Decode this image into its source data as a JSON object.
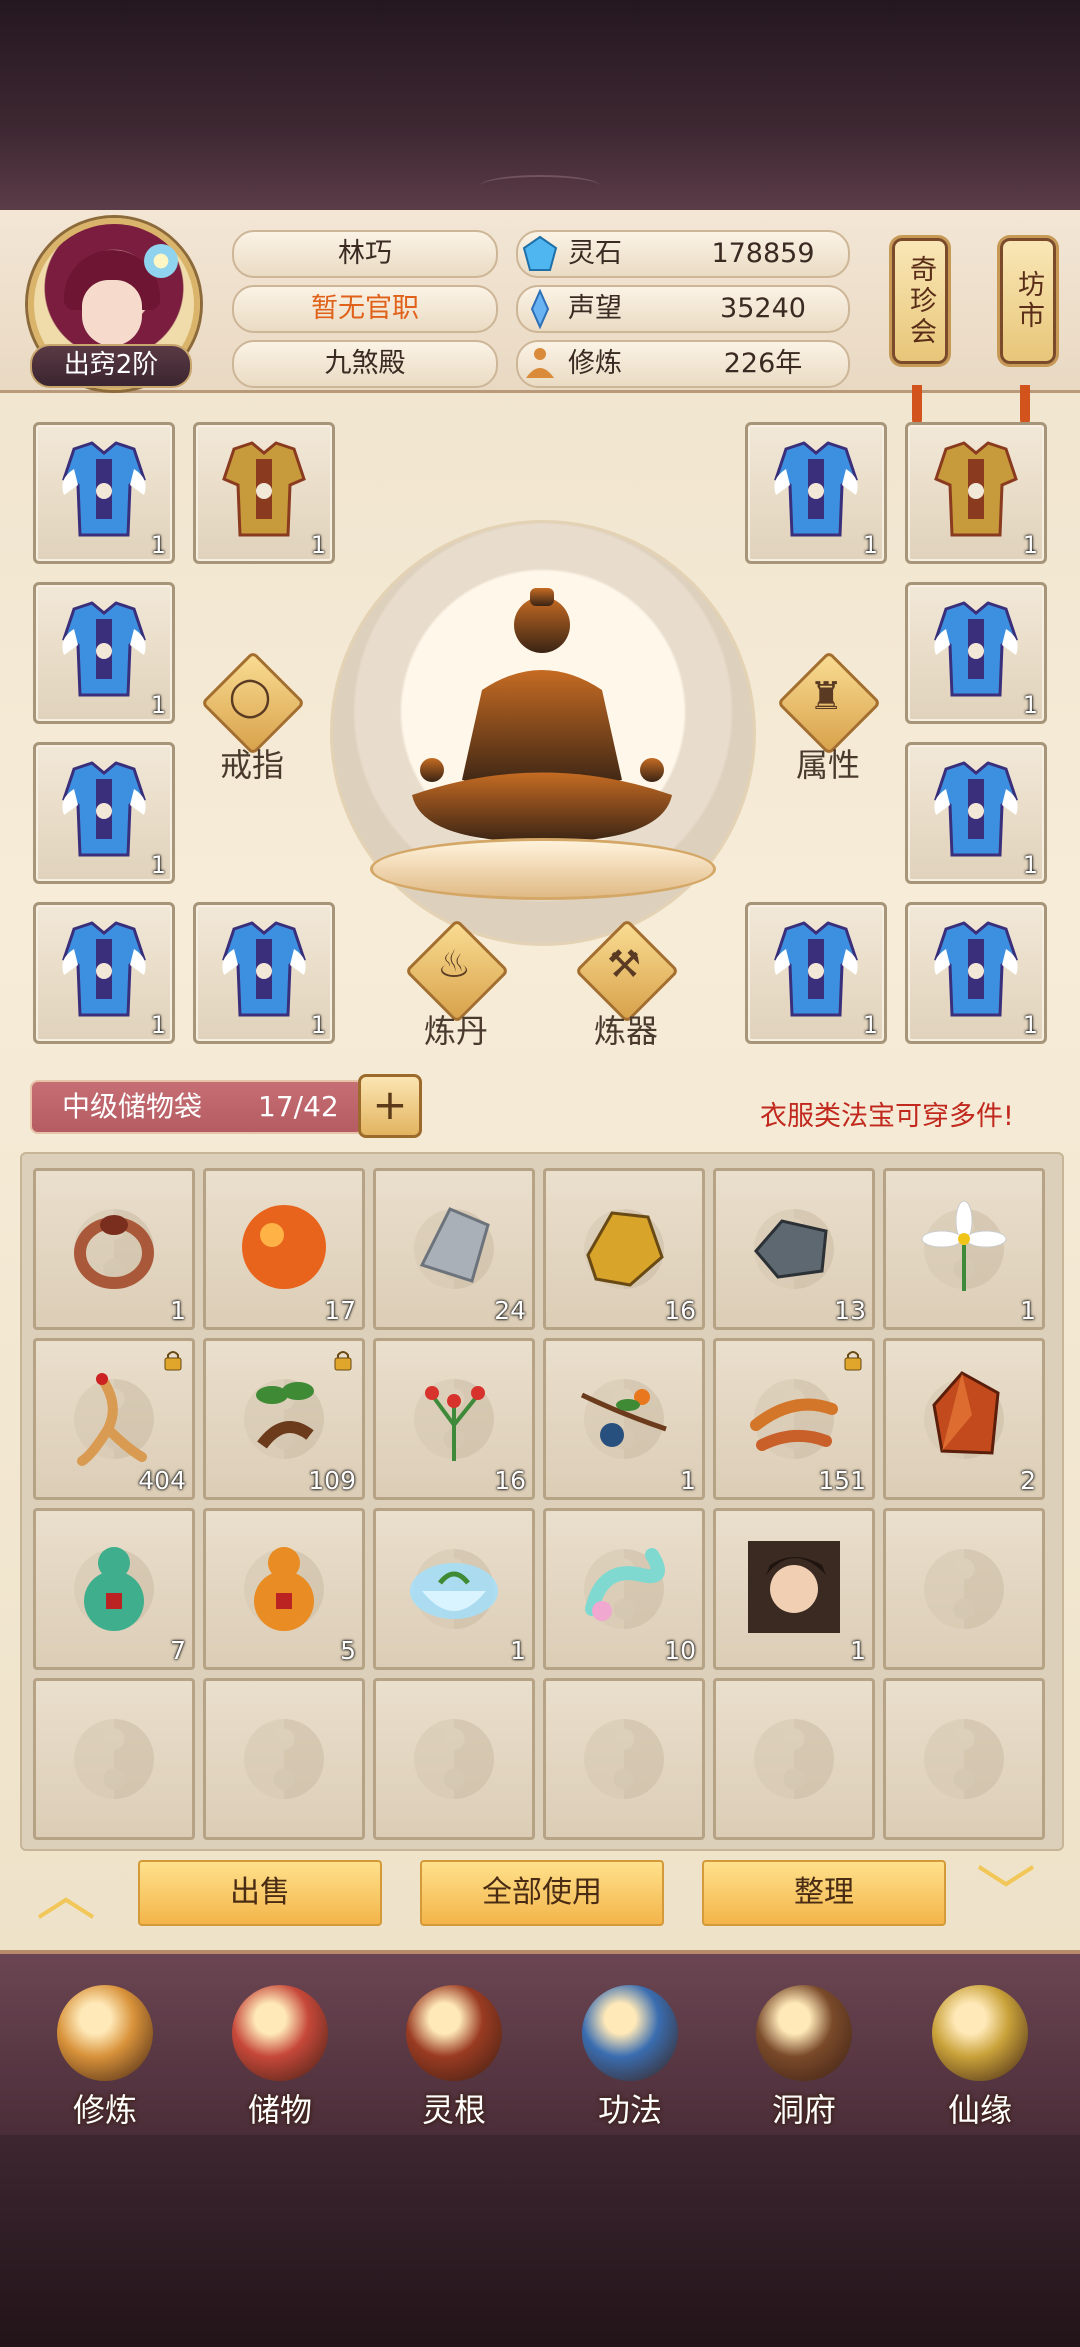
{
  "player": {
    "name": "林巧",
    "office": "暂无官职",
    "sect": "九煞殿",
    "rank": "出窍2阶"
  },
  "resources": [
    {
      "label": "灵石",
      "value": "178859",
      "icon": "spirit-stone-icon"
    },
    {
      "label": "声望",
      "value": "35240",
      "icon": "prestige-icon"
    },
    {
      "label": "修炼",
      "value": "226年",
      "icon": "cultivation-icon"
    }
  ],
  "side_tags": {
    "shop_treasure": "奇珍会",
    "market": "坊市"
  },
  "equipment": {
    "count_label": "1",
    "actions": {
      "ring": "戒指",
      "attributes": "属性",
      "alchemy": "炼丹",
      "forging": "炼器"
    }
  },
  "bag": {
    "name": "中级储物袋",
    "capacity": "17/42",
    "add_label": "+",
    "tip": "衣服类法宝可穿多件!",
    "items": [
      {
        "icon": "ring-icon",
        "count": "1",
        "locked": false
      },
      {
        "icon": "fire-orb-icon",
        "count": "17",
        "locked": false
      },
      {
        "icon": "silver-ore-icon",
        "count": "24",
        "locked": false
      },
      {
        "icon": "gold-ore-icon",
        "count": "16",
        "locked": false
      },
      {
        "icon": "iron-ore-icon",
        "count": "13",
        "locked": false
      },
      {
        "icon": "white-flower-icon",
        "count": "1",
        "locked": false
      },
      {
        "icon": "ginseng-icon",
        "count": "404",
        "locked": true
      },
      {
        "icon": "herb-root-icon",
        "count": "109",
        "locked": true
      },
      {
        "icon": "red-herb-icon",
        "count": "16",
        "locked": false
      },
      {
        "icon": "fruit-branch-icon",
        "count": "1",
        "locked": false
      },
      {
        "icon": "cordyceps-icon",
        "count": "151",
        "locked": true
      },
      {
        "icon": "red-crystal-icon",
        "count": "2",
        "locked": false
      },
      {
        "icon": "green-gourd-icon",
        "count": "7",
        "locked": false
      },
      {
        "icon": "orange-gourd-icon",
        "count": "5",
        "locked": false
      },
      {
        "icon": "jade-bowl-icon",
        "count": "1",
        "locked": false
      },
      {
        "icon": "cloud-ribbon-icon",
        "count": "10",
        "locked": false
      },
      {
        "icon": "hero-portrait-icon",
        "count": "1",
        "locked": false
      }
    ]
  },
  "actions": {
    "sell": "出售",
    "use_all": "全部使用",
    "sort": "整理"
  },
  "nav": [
    {
      "label": "修炼",
      "icon": "cultivate-nav-icon"
    },
    {
      "label": "储物",
      "icon": "storage-nav-icon"
    },
    {
      "label": "灵根",
      "icon": "spirit-root-nav-icon"
    },
    {
      "label": "功法",
      "icon": "technique-nav-icon"
    },
    {
      "label": "洞府",
      "icon": "cave-nav-icon"
    },
    {
      "label": "仙缘",
      "icon": "fate-nav-icon"
    }
  ],
  "colors": {
    "accent_gold": "#f3b54a",
    "warning_red": "#c1281e",
    "office_orange": "#e0621a"
  }
}
